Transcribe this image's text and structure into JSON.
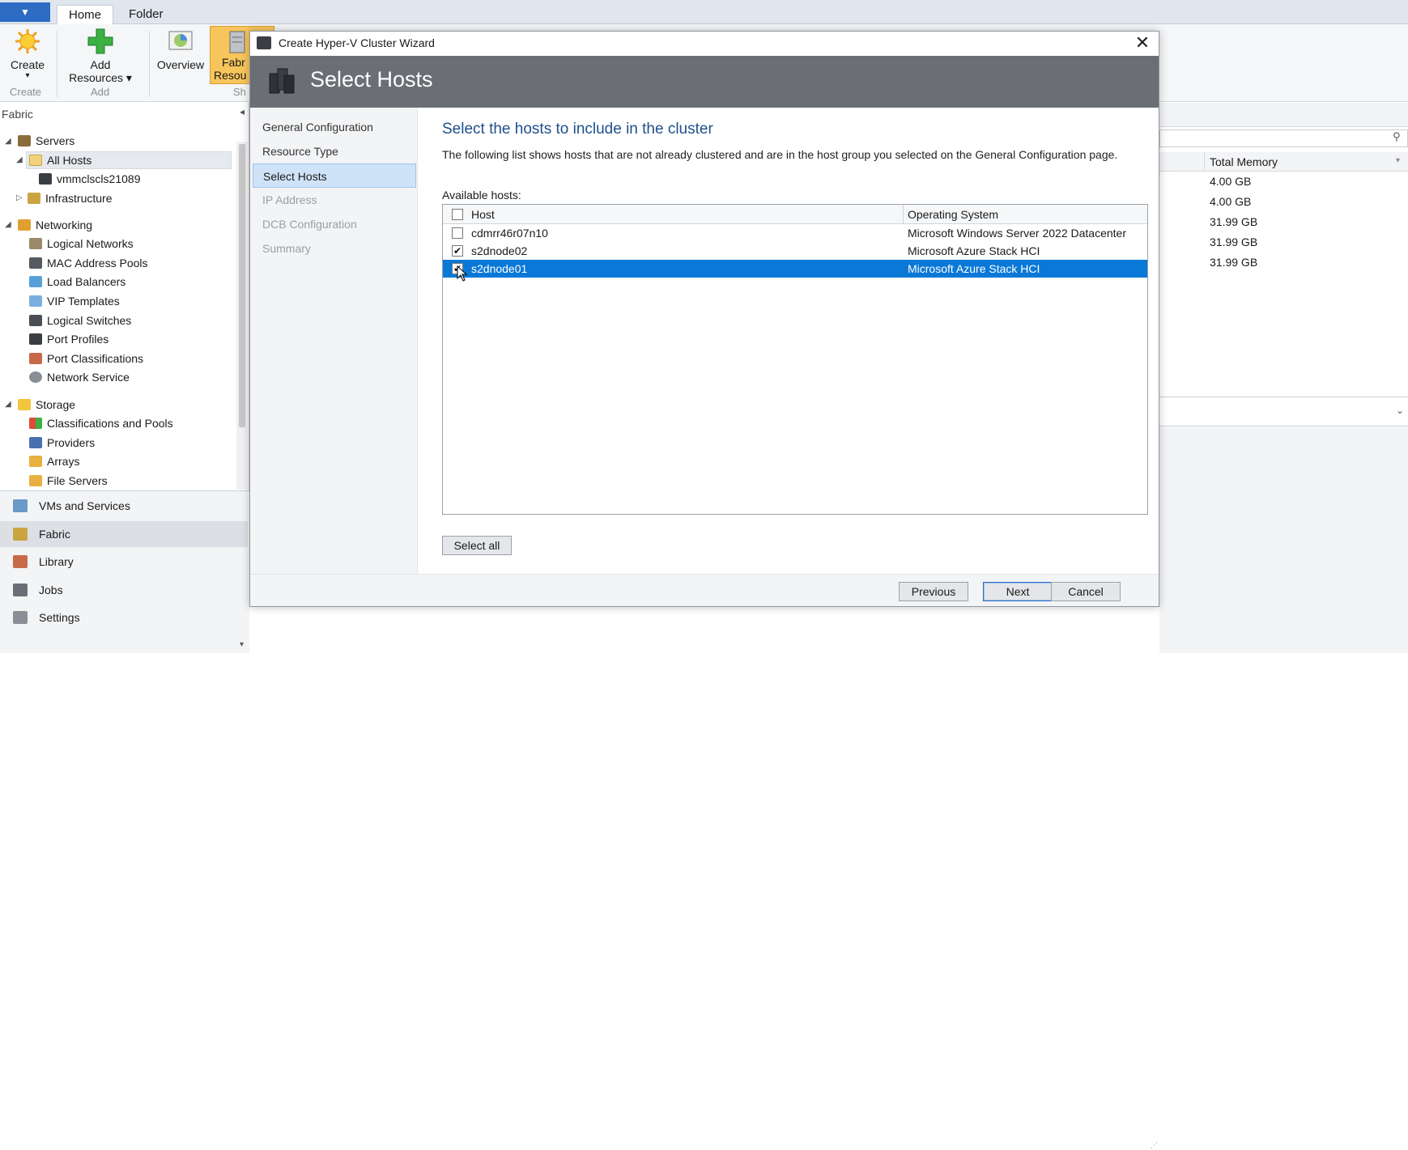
{
  "ribbon": {
    "app_menu_icon": "dropdown-arrow-icon",
    "tabs": [
      "Home",
      "Folder"
    ],
    "buttons": {
      "create": "Create",
      "add_resources_line1": "Add",
      "add_resources_line2": "Resources ▾",
      "overview": "Overview",
      "fabric_resources_line1": "Fabr",
      "fabric_resources_line2": "Resou"
    },
    "groups": {
      "create": "Create",
      "add": "Add",
      "show": "Sh"
    }
  },
  "left_nav": {
    "title": "Fabric",
    "tree": {
      "servers": "Servers",
      "all_hosts": "All Hosts",
      "host_node": "vmmclscls21089",
      "infrastructure": "Infrastructure",
      "networking": "Networking",
      "logical_networks": "Logical Networks",
      "mac_address_pools": "MAC Address Pools",
      "load_balancers": "Load Balancers",
      "vip_templates": "VIP Templates",
      "logical_switches": "Logical Switches",
      "port_profiles": "Port Profiles",
      "port_classifications": "Port Classifications",
      "network_service": "Network Service",
      "storage": "Storage",
      "classifications_and_pools": "Classifications and Pools",
      "providers": "Providers",
      "arrays": "Arrays",
      "file_servers": "File Servers"
    },
    "workspaces": {
      "vms_and_services": "VMs and Services",
      "fabric": "Fabric",
      "library": "Library",
      "jobs": "Jobs",
      "settings": "Settings"
    }
  },
  "background_grid": {
    "column_header": "Total Memory",
    "values": [
      "4.00 GB",
      "4.00 GB",
      "31.99 GB",
      "31.99 GB",
      "31.99 GB"
    ]
  },
  "dialog": {
    "title": "Create Hyper-V Cluster Wizard",
    "close_glyph": "✕",
    "banner_title": "Select Hosts",
    "steps": {
      "general_configuration": "General Configuration",
      "resource_type": "Resource Type",
      "select_hosts": "Select Hosts",
      "ip_address": "IP Address",
      "dcb_configuration": "DCB Configuration",
      "summary": "Summary"
    },
    "heading": "Select the hosts to include in the cluster",
    "description": "The following list shows hosts that are not already clustered and are in the host group you selected on the General Configuration page.",
    "available_hosts_label": "Available hosts:",
    "grid": {
      "col_host": "Host",
      "col_os": "Operating System",
      "rows": [
        {
          "host": "cdmrr46r07n10",
          "os": "Microsoft Windows Server 2022 Datacenter",
          "check": ""
        },
        {
          "host": "s2dnode02",
          "os": "Microsoft Azure Stack HCI",
          "check": "✔"
        },
        {
          "host": "s2dnode01",
          "os": "Microsoft Azure Stack HCI",
          "check": "✔"
        }
      ]
    },
    "select_all": "Select all",
    "buttons": {
      "previous": "Previous",
      "next": "Next",
      "cancel": "Cancel"
    }
  },
  "colors": {
    "selection_blue": "#0a78d7",
    "banner_gray": "#6b6f75",
    "heading_blue": "#1e4f8a",
    "ribbon_highlight": "#f7c55c"
  }
}
